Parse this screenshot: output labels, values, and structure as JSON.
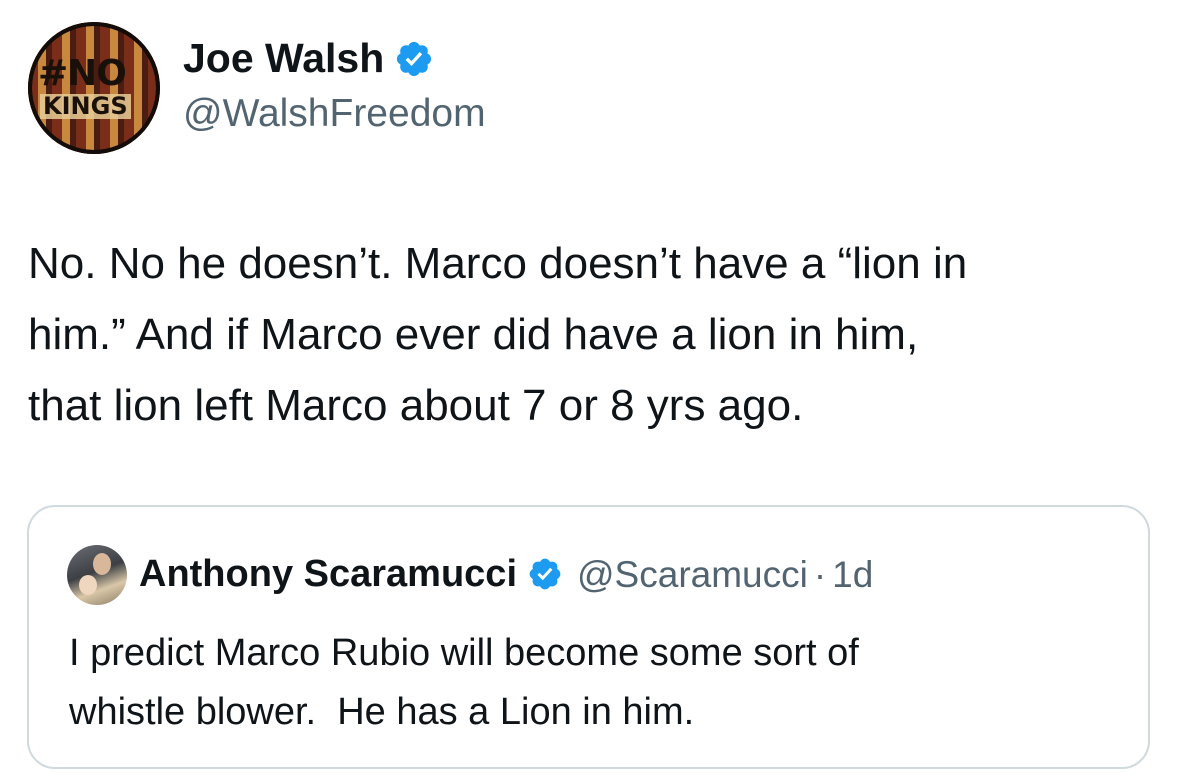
{
  "tweet": {
    "author": {
      "name": "Joe Walsh",
      "handle": "@WalshFreedom",
      "verified": true,
      "avatar": {
        "line1": "#NO",
        "line2": "KINGS"
      }
    },
    "text_lines": [
      "No. No he doesn’t. Marco doesn’t have a “lion in",
      "him.” And if Marco ever did have a lion in him,",
      "that lion left Marco about 7 or 8 yrs ago."
    ]
  },
  "quote": {
    "author": {
      "name": "Anthony Scaramucci",
      "handle": "@Scaramucci",
      "verified": true
    },
    "separator": "·",
    "time": "1d",
    "text_lines": [
      "I predict Marco Rubio will become some sort of",
      "whistle blower.  He has a Lion in him."
    ]
  },
  "colors": {
    "verified_blue": "#1d9bf0",
    "secondary_text": "#536471",
    "primary_text": "#0f1419",
    "card_border": "#cfd9de"
  },
  "icons": {
    "verified": "verified-badge-icon"
  }
}
